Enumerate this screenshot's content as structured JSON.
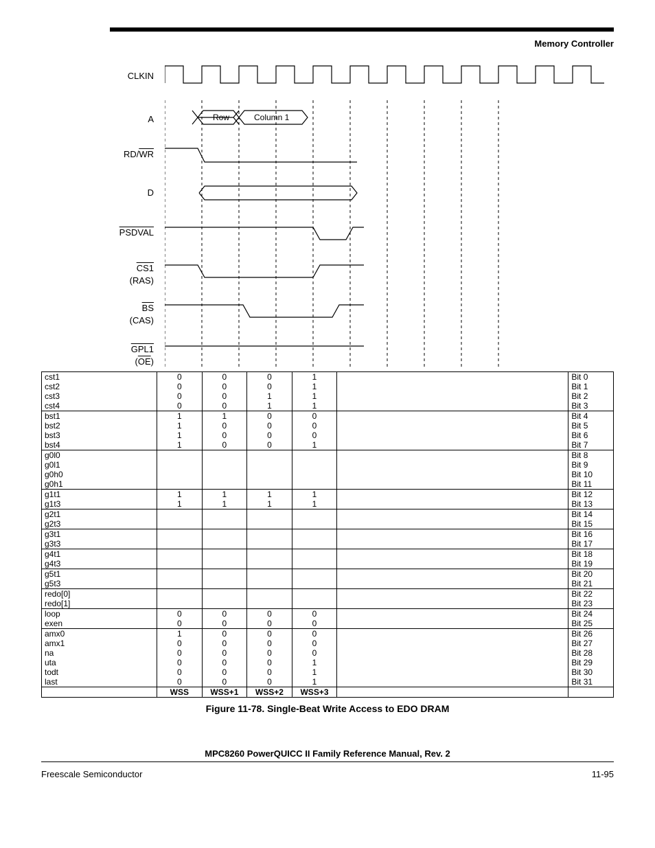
{
  "header": "Memory Controller",
  "signals": {
    "clkin": "CLKIN",
    "a": "A",
    "rdwr_pre": "RD/",
    "rdwr_over": "WR",
    "d": "D",
    "psdval_over": "PSDVAL",
    "cs1_over": "CS1",
    "ras": "(RAS)",
    "bs_over": "BS",
    "cas": "(CAS)",
    "gpl1_over": "GPL1",
    "oe_open": "(",
    "oe_over": "OE",
    "oe_close": ")",
    "row": "Row",
    "col1": "Column 1"
  },
  "table": {
    "groups": [
      {
        "rows": [
          {
            "name": "cst1",
            "w": [
              "0",
              "0",
              "0",
              "1"
            ],
            "bit": "Bit 0"
          },
          {
            "name": "cst2",
            "w": [
              "0",
              "0",
              "0",
              "1"
            ],
            "bit": "Bit 1"
          },
          {
            "name": "cst3",
            "w": [
              "0",
              "0",
              "1",
              "1"
            ],
            "bit": "Bit 2"
          },
          {
            "name": "cst4",
            "w": [
              "0",
              "0",
              "1",
              "1"
            ],
            "bit": "Bit 3"
          }
        ]
      },
      {
        "rows": [
          {
            "name": "bst1",
            "w": [
              "1",
              "1",
              "0",
              "0"
            ],
            "bit": "Bit 4"
          },
          {
            "name": "bst2",
            "w": [
              "1",
              "0",
              "0",
              "0"
            ],
            "bit": "Bit 5"
          },
          {
            "name": "bst3",
            "w": [
              "1",
              "0",
              "0",
              "0"
            ],
            "bit": "Bit 6"
          },
          {
            "name": "bst4",
            "w": [
              "1",
              "0",
              "0",
              "1"
            ],
            "bit": "Bit 7"
          }
        ]
      },
      {
        "rows": [
          {
            "name": "g0l0",
            "w": [
              "",
              "",
              "",
              ""
            ],
            "bit": "Bit 8"
          },
          {
            "name": "g0l1",
            "w": [
              "",
              "",
              "",
              ""
            ],
            "bit": "Bit 9"
          },
          {
            "name": "g0h0",
            "w": [
              "",
              "",
              "",
              ""
            ],
            "bit": "Bit 10"
          },
          {
            "name": "g0h1",
            "w": [
              "",
              "",
              "",
              ""
            ],
            "bit": "Bit 11"
          }
        ]
      },
      {
        "rows": [
          {
            "name": "g1t1",
            "w": [
              "1",
              "1",
              "1",
              "1"
            ],
            "bit": "Bit 12"
          },
          {
            "name": "g1t3",
            "w": [
              "1",
              "1",
              "1",
              "1"
            ],
            "bit": "Bit 13"
          }
        ]
      },
      {
        "rows": [
          {
            "name": "g2t1",
            "w": [
              "",
              "",
              "",
              ""
            ],
            "bit": "Bit 14"
          },
          {
            "name": "g2t3",
            "w": [
              "",
              "",
              "",
              ""
            ],
            "bit": "Bit 15"
          }
        ]
      },
      {
        "rows": [
          {
            "name": "g3t1",
            "w": [
              "",
              "",
              "",
              ""
            ],
            "bit": "Bit 16"
          },
          {
            "name": "g3t3",
            "w": [
              "",
              "",
              "",
              ""
            ],
            "bit": "Bit 17"
          }
        ]
      },
      {
        "rows": [
          {
            "name": "g4t1",
            "w": [
              "",
              "",
              "",
              ""
            ],
            "bit": "Bit 18"
          },
          {
            "name": "g4t3",
            "w": [
              "",
              "",
              "",
              ""
            ],
            "bit": "Bit 19"
          }
        ]
      },
      {
        "rows": [
          {
            "name": "g5t1",
            "w": [
              "",
              "",
              "",
              ""
            ],
            "bit": "Bit 20"
          },
          {
            "name": "g5t3",
            "w": [
              "",
              "",
              "",
              ""
            ],
            "bit": "Bit 21"
          }
        ]
      },
      {
        "rows": [
          {
            "name": "redo[0]",
            "w": [
              "",
              "",
              "",
              ""
            ],
            "bit": "Bit 22"
          },
          {
            "name": "redo[1]",
            "w": [
              "",
              "",
              "",
              ""
            ],
            "bit": "Bit 23"
          }
        ]
      },
      {
        "rows": [
          {
            "name": "loop",
            "w": [
              "0",
              "0",
              "0",
              "0"
            ],
            "bit": "Bit 24"
          },
          {
            "name": "exen",
            "w": [
              "0",
              "0",
              "0",
              "0"
            ],
            "bit": "Bit 25"
          }
        ]
      },
      {
        "rows": [
          {
            "name": "amx0",
            "w": [
              "1",
              "0",
              "0",
              "0"
            ],
            "bit": "Bit 26"
          },
          {
            "name": "amx1",
            "w": [
              "0",
              "0",
              "0",
              "0"
            ],
            "bit": "Bit 27"
          },
          {
            "name": "na",
            "w": [
              "0",
              "0",
              "0",
              "0"
            ],
            "bit": "Bit 28"
          },
          {
            "name": "uta",
            "w": [
              "0",
              "0",
              "0",
              "1"
            ],
            "bit": "Bit 29"
          },
          {
            "name": "todt",
            "w": [
              "0",
              "0",
              "0",
              "1"
            ],
            "bit": "Bit 30"
          },
          {
            "name": "last",
            "w": [
              "0",
              "0",
              "0",
              "1"
            ],
            "bit": "Bit 31"
          }
        ]
      }
    ],
    "footer": {
      "wss": "WSS",
      "w1": "WSS+1",
      "w2": "WSS+2",
      "w3": "WSS+3"
    }
  },
  "caption": "Figure 11-78. Single-Beat Write Access to EDO DRAM",
  "footer": {
    "title": "MPC8260 PowerQUICC II Family Reference Manual, Rev. 2",
    "left": "Freescale Semiconductor",
    "right": "11-95"
  }
}
